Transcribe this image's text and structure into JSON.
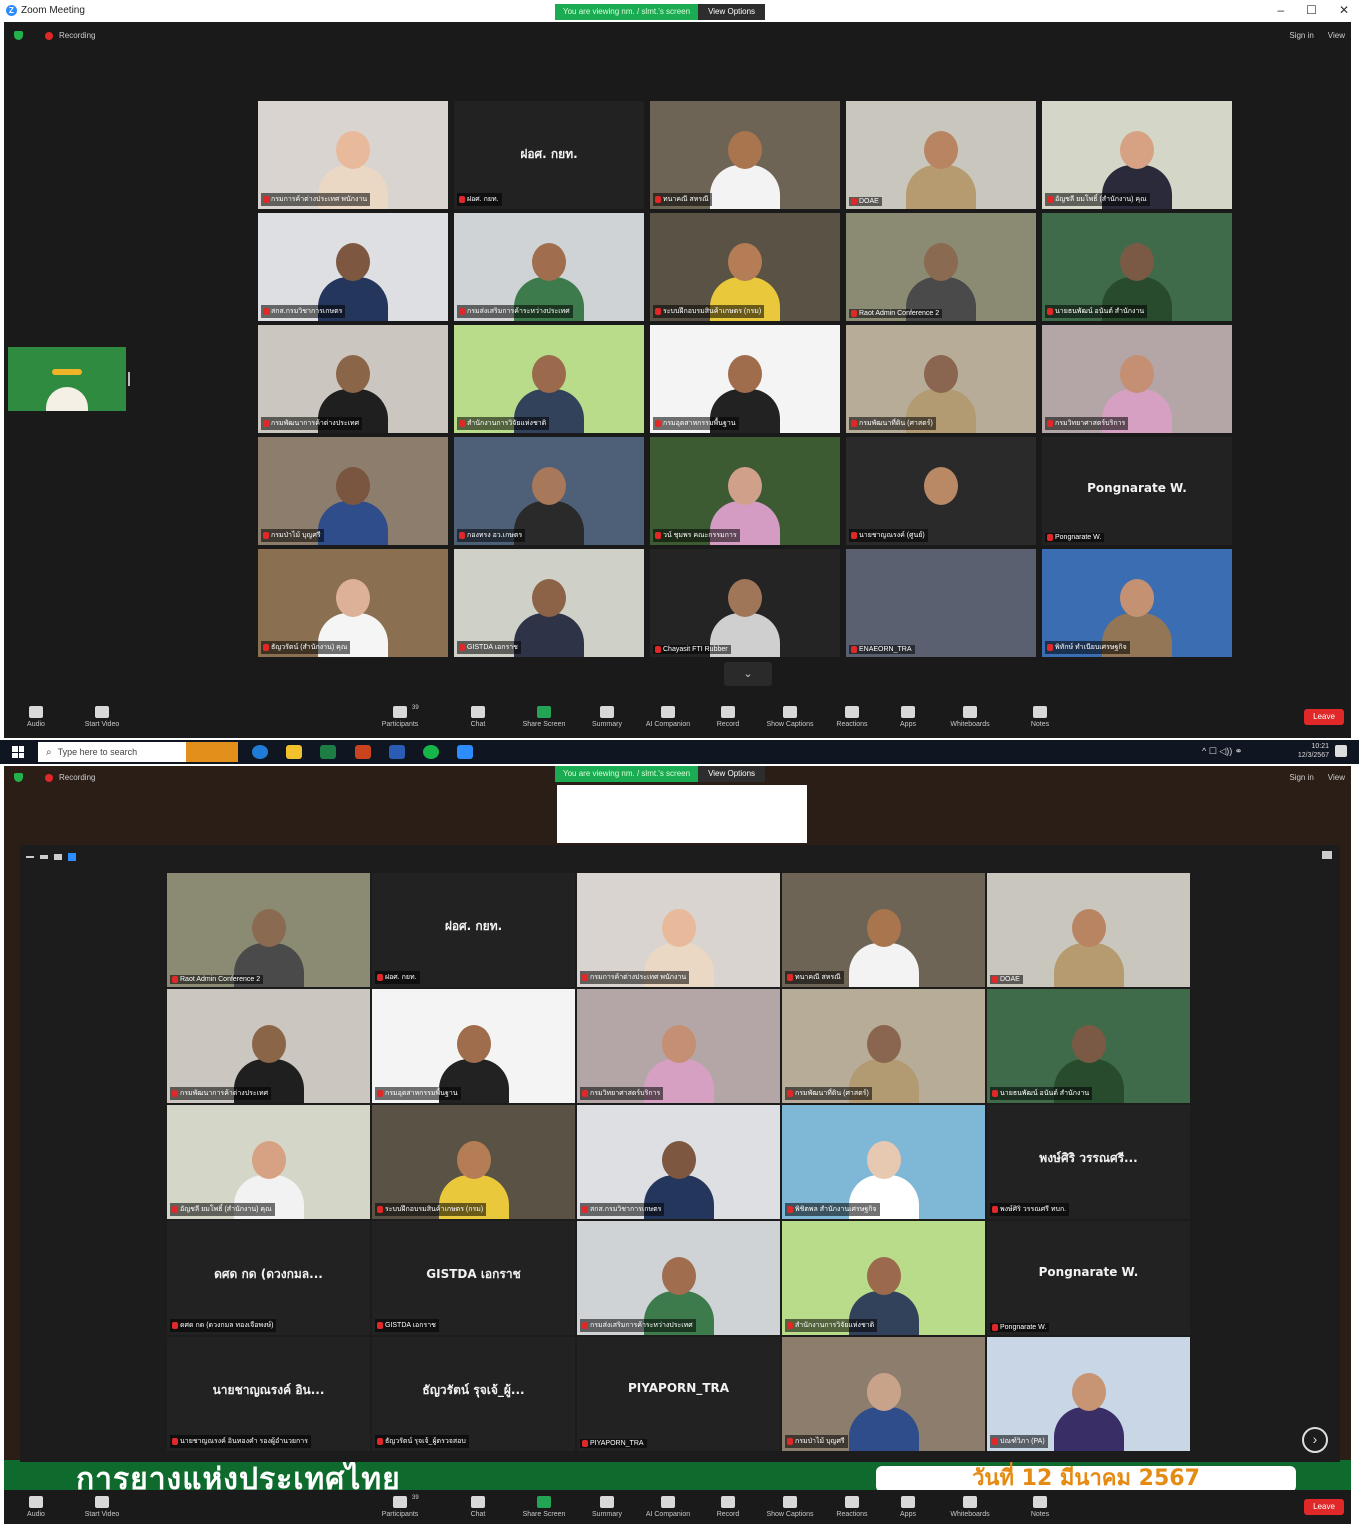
{
  "window": {
    "title": "Zoom Meeting",
    "controls": [
      "–",
      "☐",
      "✕"
    ]
  },
  "viewing_banner": {
    "text": "You are viewing nm. / slmt.'s screen",
    "view_options": "View Options"
  },
  "meeting_top": {
    "recording": "Recording",
    "sign_in": "Sign in",
    "view": "View"
  },
  "top_panel": {
    "tiles": [
      {
        "name": "กรมการค้าต่างประเทศ พนักงาน",
        "bg": "#d9d4cf",
        "skin": "#e8b99a",
        "shirt": "#ead8c4"
      },
      {
        "name": "ฝอศ. กยท.",
        "center": "ฝอศ. กยท.",
        "dark": true
      },
      {
        "name": "ทนาคณี สหรณี",
        "bg": "#6e6455",
        "skin": "#a8754f",
        "shirt": "#f3f3f3"
      },
      {
        "name": "DOAE",
        "bg": "#c9c6bd",
        "skin": "#b98461",
        "shirt": "#b59b6f"
      },
      {
        "name": "อัญชลี ยมโพธิ์ (สำนักงาน) คุณ",
        "bg": "#d4d6c8",
        "skin": "#d7a284",
        "shirt": "#2a2a3a"
      },
      {
        "name": "สกส.กรมวิชาการเกษตร",
        "bg": "#dedfe3",
        "skin": "#7d573f",
        "shirt": "#25365c"
      },
      {
        "name": "กรมส่งเสริมการค้าระหว่างประเทศ",
        "bg": "#cfd3d6",
        "skin": "#a06e4f",
        "shirt": "#3d7a4c"
      },
      {
        "name": "ระบบฝึกอบรมสินค้าเกษตร (กรม)",
        "bg": "#5b5246",
        "skin": "#b57d55",
        "shirt": "#e9c83b"
      },
      {
        "name": "Raot Admin Conference 2",
        "bg": "#8b8b73",
        "skin": "#8a6a50",
        "shirt": "#4a4a4a",
        "active": true
      },
      {
        "name": "นายธนพัฒน์ อนันต์ สำนักงาน",
        "bg": "#3f6b4b",
        "skin": "#7a5a45",
        "shirt": "#284b2d"
      },
      {
        "name": "กรมพัฒนาการค้าต่างประเทศ",
        "bg": "#cbc6bf",
        "skin": "#8b6548",
        "shirt": "#1f1f1f"
      },
      {
        "name": "สำนักงานการวิจัยแห่งชาติ",
        "bg": "#b8dc8a",
        "skin": "#9b6a4c",
        "shirt": "#32425a"
      },
      {
        "name": "กรมอุตสาหกรรมพื้นฐาน",
        "bg": "#f4f4f4",
        "skin": "#a06d4c",
        "shirt": "#222"
      },
      {
        "name": "กรมพัฒนาที่ดิน (ศาสตร์)",
        "bg": "#b7ac98",
        "skin": "#8a6550",
        "shirt": "#b29a72"
      },
      {
        "name": "กรมวิทยาศาสตร์บริการ",
        "bg": "#b4a6a6",
        "skin": "#c48f72",
        "shirt": "#d6a0c2"
      },
      {
        "name": "กรมป่าไม้ บุญศรี",
        "bg": "#8c7d6c",
        "skin": "#7a553f",
        "shirt": "#2e4d8a"
      },
      {
        "name": "กองทรง อว.เกษตร",
        "bg": "#4e5f78",
        "skin": "#a77859",
        "shirt": "#2a2a2a"
      },
      {
        "name": "วน์ ชุมพร คณะกรรมการ",
        "bg": "#3d5b33",
        "skin": "#d0a08b",
        "shirt": "#d59cc3"
      },
      {
        "name": "นายชาญณรงค์ (ศูนย์)",
        "bg": "#2a2a2a",
        "skin": "#b98966",
        "shirt": "#2a2a2a"
      },
      {
        "name": "Pongnarate W.",
        "center": "Pongnarate W.",
        "dark": true
      },
      {
        "name": "ธัญวรัตน์ (สำนักงาน) คุณ",
        "bg": "#8a7050",
        "skin": "#ddb197",
        "shirt": "#f5f5f5"
      },
      {
        "name": "GISTDA เอกราช",
        "bg": "#cfd1c8",
        "skin": "#8d6347",
        "shirt": "#2e3348"
      },
      {
        "name": "Chayasit FTI Rubber",
        "bg": "#242424",
        "skin": "#a07658",
        "shirt": "#cfcfcf"
      },
      {
        "name": "ENAEORN_TRA",
        "bg": "#5a6070",
        "skin": "#5a6070",
        "shirt": "#5a6070"
      },
      {
        "name": "พิทักษ์ ทำเนียบเศรษฐกิจ",
        "bg": "#3a6db2",
        "skin": "#c49273",
        "shirt": "#927656"
      }
    ]
  },
  "toolbar": {
    "audio": "Audio",
    "start_video": "Start Video",
    "participants": "Participants",
    "participant_count": "39",
    "chat": "Chat",
    "share_screen": "Share Screen",
    "summary": "Summary",
    "ai_companion": "AI Companion",
    "record": "Record",
    "show_captions": "Show Captions",
    "reactions": "Reactions",
    "apps": "Apps",
    "whiteboards": "Whiteboards",
    "notes": "Notes",
    "leave": "Leave"
  },
  "taskbar": {
    "search_placeholder": "Type here to search",
    "time": "10:21",
    "date": "12/3/2567"
  },
  "bottom_panel": {
    "tiles": [
      {
        "name": "Raot Admin Conference 2",
        "bg": "#8b8b73",
        "skin": "#8a6a50",
        "shirt": "#4a4a4a",
        "active": true
      },
      {
        "name": "ฝอศ. กยท.",
        "center": "ฝอศ. กยท.",
        "dark": true
      },
      {
        "name": "กรมการค้าต่างประเทศ พนักงาน",
        "bg": "#d9d4cf",
        "skin": "#e8b99a",
        "shirt": "#ead8c4"
      },
      {
        "name": "ทนาคณี สหรณี",
        "bg": "#6e6455",
        "skin": "#a8754f",
        "shirt": "#f3f3f3"
      },
      {
        "name": "DOAE",
        "bg": "#c9c6bd",
        "skin": "#b98461",
        "shirt": "#b59b6f"
      },
      {
        "name": "กรมพัฒนาการค้าต่างประเทศ",
        "bg": "#cbc6bf",
        "skin": "#8b6548",
        "shirt": "#1f1f1f"
      },
      {
        "name": "กรมอุตสาหกรรมพื้นฐาน",
        "bg": "#f4f4f4",
        "skin": "#a06d4c",
        "shirt": "#222"
      },
      {
        "name": "กรมวิทยาศาสตร์บริการ",
        "bg": "#b4a6a6",
        "skin": "#c48f72",
        "shirt": "#d6a0c2"
      },
      {
        "name": "กรมพัฒนาที่ดิน (ศาสตร์)",
        "bg": "#b7ac98",
        "skin": "#8a6550",
        "shirt": "#b29a72"
      },
      {
        "name": "นายธนพัฒน์ อนันต์ สำนักงาน",
        "bg": "#3f6b4b",
        "skin": "#7a5a45",
        "shirt": "#284b2d"
      },
      {
        "name": "อัญชลี ยมโพธิ์ (สำนักงาน) คุณ",
        "bg": "#d4d6c8",
        "skin": "#d7a284",
        "shirt": "#f2f2f2"
      },
      {
        "name": "ระบบฝึกอบรมสินค้าเกษตร (กรม)",
        "bg": "#5b5246",
        "skin": "#b57d55",
        "shirt": "#e9c83b"
      },
      {
        "name": "สกส.กรมวิชาการเกษตร",
        "bg": "#dedfe3",
        "skin": "#7d573f",
        "shirt": "#25365c"
      },
      {
        "name": "พิชิตพล สำนักงานเศรษฐกิจ",
        "bg": "#7fb8d6",
        "skin": "#e7c8b0",
        "shirt": "#ffffff"
      },
      {
        "name": "พงษ์ศิริ วรรณศรี ทบก.",
        "center": "พงษ์ศิริ วรรณศรี...",
        "dark": true
      },
      {
        "name": "ดศด กด (ดวงกมล ทองเจือพงษ์)",
        "center": "ดศด กด (ดวงกมล...",
        "dark": true
      },
      {
        "name": "GISTDA เอกราช",
        "center": "GISTDA เอกราช",
        "dark": true
      },
      {
        "name": "กรมส่งเสริมการค้าระหว่างประเทศ",
        "bg": "#cfd3d6",
        "skin": "#a06e4f",
        "shirt": "#3d7a4c"
      },
      {
        "name": "สำนักงานการวิจัยแห่งชาติ",
        "bg": "#b8dc8a",
        "skin": "#9b6a4c",
        "shirt": "#32425a"
      },
      {
        "name": "Pongnarate W.",
        "center": "Pongnarate W.",
        "dark": true
      },
      {
        "name": "นายชาญณรงค์ อินทองคำ รองผู้อำนวยการ",
        "center": "นายชาญณรงค์ อิน...",
        "dark": true
      },
      {
        "name": "ธัญวรัตน์ รุจเจ้_ผู้ตรวจสอบ",
        "center": "ธัญวรัตน์ รุจเจ้_ผู้...",
        "dark": true
      },
      {
        "name": "PIYAPORN_TRA",
        "center": "PIYAPORN_TRA",
        "dark": true
      },
      {
        "name": "กรมป่าไม้ บุญศรี",
        "bg": "#8c7d6c",
        "skin": "#c9a28a",
        "shirt": "#2e4d8a"
      },
      {
        "name": "ปณฑ์วิภา (PA)",
        "bg": "#c8d6e6",
        "skin": "#c79574",
        "shirt": "#3a2e66"
      }
    ]
  },
  "banner": {
    "text": "การยางแห่งประเทศไทย",
    "date": "วันที่ 12 มีนาคม 2567"
  }
}
